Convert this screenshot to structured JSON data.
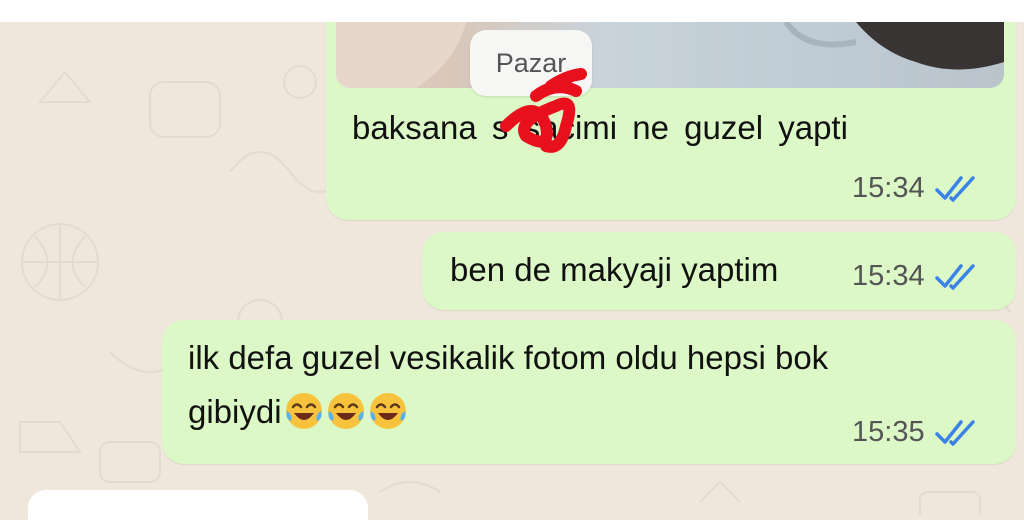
{
  "chat": {
    "date_separator": "Pazar",
    "messages": [
      {
        "text": "baksana s sacimi ne guzel yapti",
        "time": "15:34",
        "status": "read"
      },
      {
        "text": "ben de makyaji yaptim",
        "time": "15:34",
        "status": "read"
      },
      {
        "text_line1": "ilk defa guzel vesikalik fotom oldu hepsi bok",
        "text_line2": "gibiydi",
        "emojis": [
          "face-with-tears-of-joy",
          "face-with-tears-of-joy",
          "face-with-tears-of-joy"
        ],
        "time": "15:35",
        "status": "read"
      }
    ]
  },
  "colors": {
    "outgoing_bubble": "#dcf8c6",
    "chat_background": "#efe7dc",
    "read_ticks": "#3b82e6",
    "scribble": "#e8101c"
  }
}
